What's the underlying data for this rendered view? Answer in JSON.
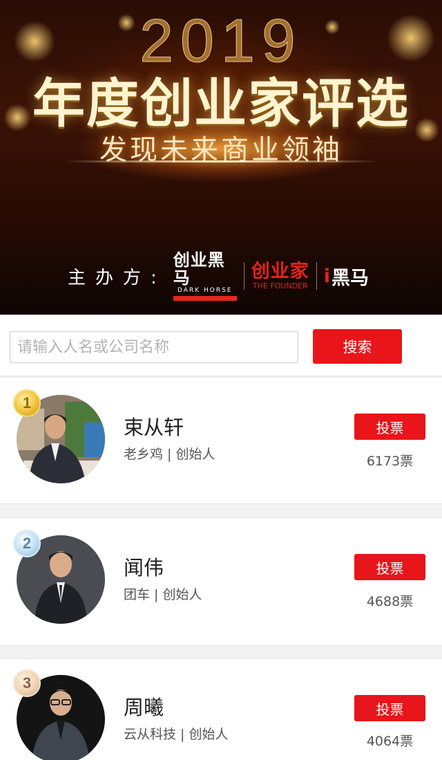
{
  "banner": {
    "year": "2019",
    "headline": "年度创业家评选",
    "subline": "发现未来商业领袖",
    "organizer_label": "主办方:",
    "organizers": {
      "dark_horse_cn": "创业黑马",
      "dark_horse_en": "DARK HORSE",
      "founder_cn": "创业家",
      "founder_en": "THE FOUNDER",
      "iheima_i": "i",
      "iheima_cn": "黑马"
    }
  },
  "search": {
    "placeholder": "请输入人名或公司名称",
    "button_label": "搜索"
  },
  "candidates": [
    {
      "rank": "1",
      "name": "束从轩",
      "title": "老乡鸡 | 创始人",
      "vote_label": "投票",
      "votes": "6173票"
    },
    {
      "rank": "2",
      "name": "闻伟",
      "title": "团车 | 创始人",
      "vote_label": "投票",
      "votes": "4688票"
    },
    {
      "rank": "3",
      "name": "周曦",
      "title": "云从科技 | 创始人",
      "vote_label": "投票",
      "votes": "4064票"
    }
  ],
  "colors": {
    "accent_red": "#e8151a",
    "gold_medal": "#f0c23a",
    "silver_medal": "#bfe0f2",
    "bronze_medal": "#f0d4b2"
  }
}
